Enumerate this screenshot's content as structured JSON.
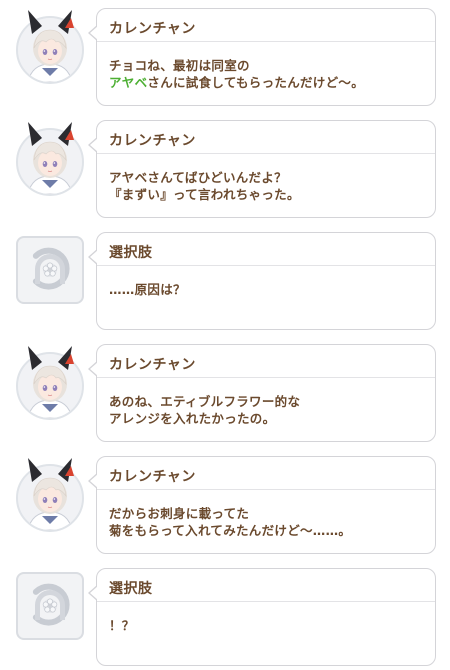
{
  "messages": [
    {
      "type": "character",
      "speaker": "カレンチャン",
      "segments": [
        {
          "text": "チョコね、最初は同室の",
          "style": "normal"
        },
        {
          "text": "\n",
          "style": "normal"
        },
        {
          "text": "アヤベ",
          "style": "highlight"
        },
        {
          "text": "さんに試食してもらったんだけど～。",
          "style": "normal"
        }
      ]
    },
    {
      "type": "character",
      "speaker": "カレンチャン",
      "segments": [
        {
          "text": "アヤベさんてばひどいんだよ？\n『まずい』って言われちゃった。",
          "style": "normal"
        }
      ]
    },
    {
      "type": "choice",
      "speaker": "選択肢",
      "segments": [
        {
          "text": "……原因は？",
          "style": "normal"
        }
      ]
    },
    {
      "type": "character",
      "speaker": "カレンチャン",
      "segments": [
        {
          "text": "あのね、エティブルフラワー的な\nアレンジを入れたかったの。",
          "style": "normal"
        }
      ]
    },
    {
      "type": "character",
      "speaker": "カレンチャン",
      "segments": [
        {
          "text": "だからお刺身に載ってた\n菊をもらって入れてみたんだけど～……。",
          "style": "normal"
        }
      ]
    },
    {
      "type": "choice",
      "speaker": "選択肢",
      "segments": [
        {
          "text": "！？",
          "style": "normal"
        }
      ]
    }
  ],
  "colors": {
    "text": "#6b4a2e",
    "highlight": "#4caf32",
    "border": "#d4d4d8"
  },
  "icons": {
    "character_avatar": "karen-chan-portrait",
    "choice_avatar": "horseshoe-flower-icon"
  }
}
